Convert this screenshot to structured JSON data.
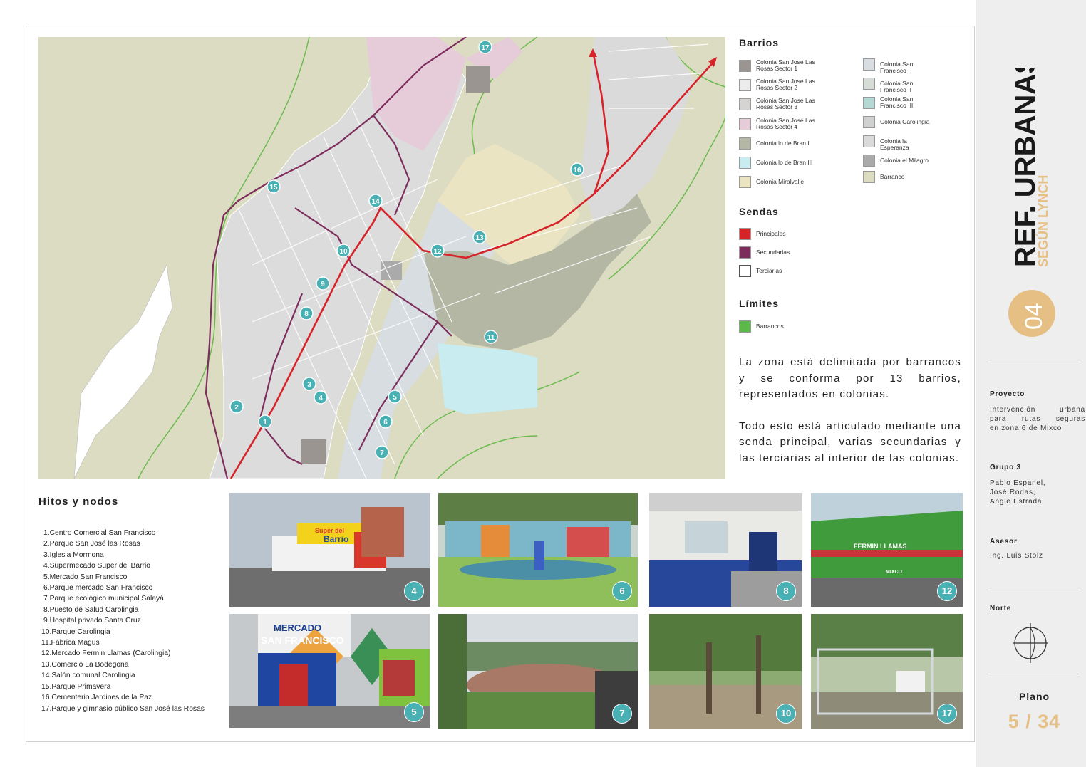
{
  "legend": {
    "barrios_title": "Barrios",
    "barrios": [
      {
        "label": "Colonia San José Las Rosas Sector 1",
        "color": "#9b9592"
      },
      {
        "label": "Colonia San José Las Rosas Sector 2",
        "color": "#ececec"
      },
      {
        "label": "Colonia San José Las Rosas Sector 3",
        "color": "#d6d4d2"
      },
      {
        "label": "Colonia San José Las Rosas Sector 4",
        "color": "#e6cbd9"
      },
      {
        "label": "Colonia lo de Bran I",
        "color": "#b4b7a4"
      },
      {
        "label": "Colonia lo de Bran III",
        "color": "#c8ecef"
      },
      {
        "label": "Colonia Miralvalle",
        "color": "#ebe4c2"
      },
      {
        "label": "Colonia San Francisco I",
        "color": "#d7dde0"
      },
      {
        "label": "Colonia San Francisco II",
        "color": "#d6ddd7"
      },
      {
        "label": "Colonia San Francisco III",
        "color": "#b5d8d4"
      },
      {
        "label": "Colonia Carolingia",
        "color": "#cfd1d0"
      },
      {
        "label": "Colonia la Esperanza",
        "color": "#dadada"
      },
      {
        "label": "Colonia el Milagro",
        "color": "#aaaaaa"
      },
      {
        "label": "Barranco",
        "color": "#dcdcc2"
      }
    ],
    "sendas_title": "Sendas",
    "sendas": [
      {
        "label": "Principales",
        "color": "#d6232a"
      },
      {
        "label": "Secundarias",
        "color": "#7d2d5c"
      },
      {
        "label": "Terciarias",
        "color": "#ffffff"
      }
    ],
    "limites_title": "Límites",
    "limites": [
      {
        "label": "Barrancos",
        "color": "#5db84a"
      }
    ]
  },
  "description": [
    "La zona está delimitada por barrancos y se conforma por 13 barrios, representados en colonias.",
    "Todo esto está articulado mediante una senda principal, varias secundarias y las terciarias al interior de las colonias."
  ],
  "hitos": {
    "title": "Hitos y nodos",
    "items": [
      "1.Centro Comercial San Francisco",
      "2.Parque San José las Rosas",
      "3.Iglesia Mormona",
      "4.Supermecado Super del Barrio",
      "5.Mercado San Francisco",
      "6.Parque mercado San Francisco",
      "7.Parque ecológico municipal Salayá",
      "8.Puesto de Salud Carolingia",
      "9.Hospital privado Santa Cruz",
      "10.Parque Carolingia",
      "11.Fábrica Magus",
      "12.Mercado Fermin Llamas (Carolingia)",
      "13.Comercio La Bodegona",
      "14.Salón comunal Carolingia",
      "15.Parque Primavera",
      "16.Cementerio Jardines de la Paz",
      "17.Parque y gimnasio público San José las Rosas"
    ]
  },
  "map_markers": [
    "1",
    "2",
    "3",
    "4",
    "5",
    "6",
    "7",
    "8",
    "9",
    "10",
    "11",
    "12",
    "13",
    "14",
    "15",
    "16",
    "17"
  ],
  "photos": [
    {
      "badge": "4",
      "text": [
        "Super del",
        "Barrio"
      ]
    },
    {
      "badge": "6"
    },
    {
      "badge": "8"
    },
    {
      "badge": "12",
      "text": [
        "FERMIN LLAMAS",
        "MIXCO"
      ]
    },
    {
      "badge": "5",
      "text": [
        "MERCADO",
        "SAN FRANCISCO"
      ]
    },
    {
      "badge": "7"
    },
    {
      "badge": "10"
    },
    {
      "badge": "17"
    }
  ],
  "sidebar": {
    "title": "REF. URBANAS",
    "subtitle": "SEGÚN LYNCH",
    "number": "04",
    "proyecto_label": "Proyecto",
    "proyecto_text": [
      "Intervención urbana",
      "para rutas seguras",
      "en zona 6 de Mixco"
    ],
    "grupo_label": "Grupo 3",
    "grupo_text": [
      "Pablo Espanel,",
      "José Rodas,",
      "Angie Estrada"
    ],
    "asesor_label": "Asesor",
    "asesor_text": "Ing. Luis Stolz",
    "norte_label": "Norte",
    "plano_label": "Plano",
    "plano_value": "5 / 34",
    "accent": "#e6bf85"
  }
}
